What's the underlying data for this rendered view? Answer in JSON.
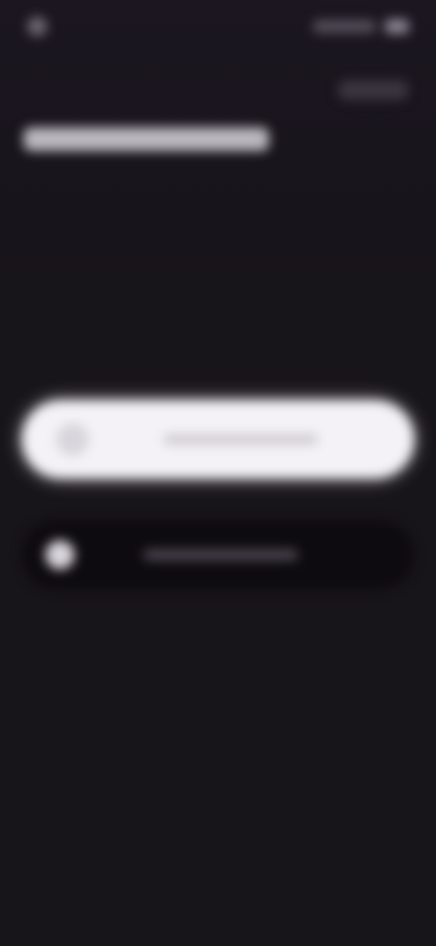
{
  "status_bar": {
    "time": "",
    "battery_icon": "battery-icon",
    "signal_icon": "signal-icon"
  },
  "header": {
    "left_text": "",
    "right_text": ""
  },
  "page": {
    "title": ""
  },
  "actions": {
    "primary": {
      "label": "",
      "icon": "app-icon"
    },
    "secondary": {
      "label": "",
      "icon": "account-icon"
    }
  },
  "colors": {
    "background": "#17141a",
    "primary_button": "#f4f2f6",
    "secondary_button": "#0e0b10"
  }
}
